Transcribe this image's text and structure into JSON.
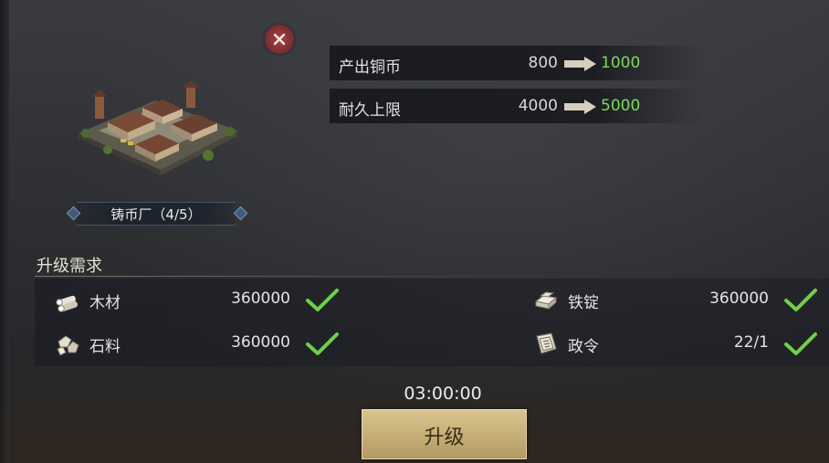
{
  "building": {
    "name_label": "铸币厂（4/5）"
  },
  "stats": [
    {
      "name": "产出铜币",
      "old": "800",
      "new": "1000"
    },
    {
      "name": "耐久上限",
      "old": "4000",
      "new": "5000"
    }
  ],
  "requirements": {
    "title": "升级需求",
    "items": [
      {
        "name": "木材",
        "amount": "360000",
        "icon": "wood-icon",
        "met": true
      },
      {
        "name": "铁锭",
        "amount": "360000",
        "icon": "iron-ingot-icon",
        "met": true
      },
      {
        "name": "石料",
        "amount": "360000",
        "icon": "stone-icon",
        "met": true
      },
      {
        "name": "政令",
        "amount": "22/1",
        "icon": "decree-icon",
        "met": true
      }
    ]
  },
  "timer": "03:00:00",
  "upgrade_button": {
    "label": "升级"
  },
  "colors": {
    "new_value": "#7ed957",
    "check": "#6fcf4a",
    "close_button": "#8a3335",
    "button_gold": "#c9b17a"
  }
}
